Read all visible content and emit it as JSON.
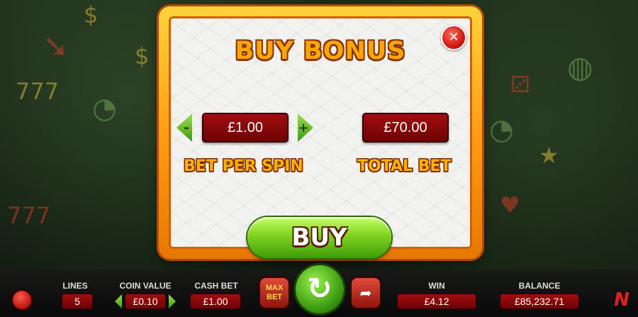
{
  "modal": {
    "title": "BUY BONUS",
    "close_icon": "close-x-icon",
    "bet_per_spin": {
      "label": "BET PER SPIN",
      "value": "£1.00",
      "decrease_symbol": "-",
      "increase_symbol": "+"
    },
    "total_bet": {
      "label": "TOTAL BET",
      "value": "£70.00"
    },
    "buy_label": "BUY"
  },
  "bottom_bar": {
    "lines": {
      "label": "LINES",
      "value": "5"
    },
    "coin_value": {
      "label": "COIN VALUE",
      "value": "£0.10"
    },
    "cash_bet": {
      "label": "CASH BET",
      "value": "£1.00"
    },
    "max_bet_label": "MAX\nBET",
    "spin_icon": "refresh-arrow-icon",
    "auto_icon": "auto-play-arrow-icon",
    "win": {
      "label": "WIN",
      "value": "£4.12"
    },
    "balance": {
      "label": "BALANCE",
      "value": "£85,232.71"
    },
    "logo_icon": "brand-logo-icon"
  },
  "colors": {
    "accent_orange": "#ff9d13",
    "value_box_red": "#8a0608",
    "button_green": "#7fd31e"
  }
}
